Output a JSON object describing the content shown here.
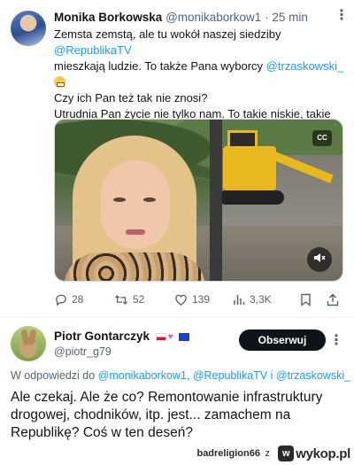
{
  "tweet": {
    "author_name": "Monika Borkowska",
    "author_handle": "@monikaborkow1",
    "time": "· 25 min",
    "text_lines": [
      "Zemsta zemstą, ale tu wokół naszej siedziby ",
      "@RepublikaTV",
      " mieszkają ludzie. To także Pana wyborcy ",
      "@trzaskowski_",
      "Czy ich Pan też tak nie znosi?",
      "Utrudnia Pan życie nie tylko nam. To takie niskie, takie dziecinne.",
      "❗❗❗❗❗❗❗❗"
    ],
    "media_cc_label": "CC",
    "stats": {
      "replies": "28",
      "retweets": "52",
      "likes": "139",
      "views": "3,3K"
    }
  },
  "reply": {
    "author_name": "Piotr Gontarczyk",
    "author_handle": "@piotr_g79",
    "follow_label": "Obserwuj",
    "reply_prefix": "W odpowiedzi do ",
    "reply_mentions": "@monikaborkow1, @RepublikaTV i @trzaskowski_",
    "text": "Ale czekaj. Ale że co? Remontowanie infrastruktury drogowej, chodników, itp. jest... zamachem na Republikę? Coś w ten deseń?"
  },
  "footer": {
    "user": "badreligion66",
    "sep": "z",
    "site": "wykop.pl"
  },
  "colors": {
    "accent": "#1d9bf0",
    "text": "#0f1419",
    "muted": "#536471",
    "exclamation": "#e0192e"
  }
}
